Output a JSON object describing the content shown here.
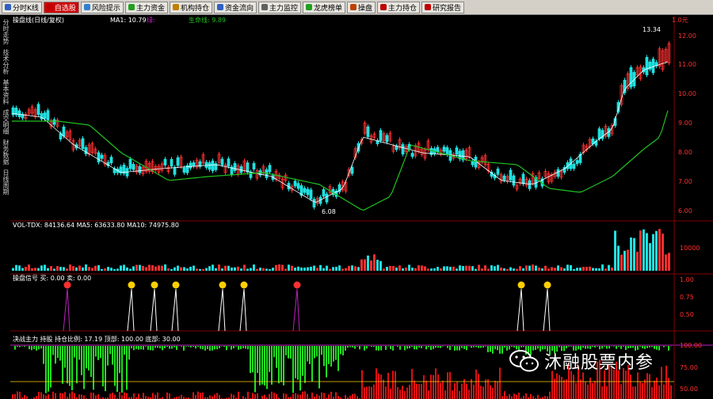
{
  "toolbar": {
    "items": [
      {
        "label": "分时K线",
        "color": "#3060c0",
        "active": false
      },
      {
        "label": "自选股",
        "color": "#c00000",
        "active": true
      },
      {
        "label": "风险提示",
        "color": "#3080d0",
        "active": false
      },
      {
        "label": "主力资金",
        "color": "#20a020",
        "active": false
      },
      {
        "label": "机构持仓",
        "color": "#c08000",
        "active": false
      },
      {
        "label": "资金流向",
        "color": "#3060c0",
        "active": false
      },
      {
        "label": "主力监控",
        "color": "#606060",
        "active": false
      },
      {
        "label": "龙虎榜单",
        "color": "#20a020",
        "active": false
      },
      {
        "label": "操盘",
        "color": "#c04000",
        "active": false
      },
      {
        "label": "主力持仓",
        "color": "#c00000",
        "active": false
      },
      {
        "label": "研究报告",
        "color": "#c00000",
        "active": false
      }
    ]
  },
  "sidebar": {
    "items": [
      "分时走势",
      "技术分析",
      "基本资料",
      "成交明细",
      "财务数据",
      "日线周期"
    ]
  },
  "main": {
    "title": "操盘线(日线/复权)",
    "ma_label": "MA1: 10.79",
    "ma2_label": "绿:",
    "ma3_label": "生命线: 9.89",
    "high_label": "13.34",
    "low_label": "6.08",
    "top_right": "1.0元",
    "price_ticks": [
      "12.00",
      "11.00",
      "10.00",
      "9.00",
      "8.00",
      "7.00",
      "6.00"
    ],
    "colors": {
      "up": "#ff3030",
      "down": "#20e0e0",
      "ma": "#20c020",
      "line": "#ffffff",
      "grid": "#800000"
    }
  },
  "volume": {
    "label": "VOL-TDX: 84136.64  MA5: 63633.80  MA10: 74975.80",
    "tick": "10000"
  },
  "signal": {
    "label": "操盘信号  买: 0.00  卖: 0.00",
    "ticks": [
      "1.00",
      "0.75",
      "0.50"
    ]
  },
  "bottom": {
    "label": "决战主力  持股  持仓比例: 17.19  顶部: 100.00  底部: 30.00",
    "ticks": [
      "100.00",
      "75.00",
      "50.00"
    ]
  },
  "watermark": {
    "text": "沐融股票内参"
  }
}
